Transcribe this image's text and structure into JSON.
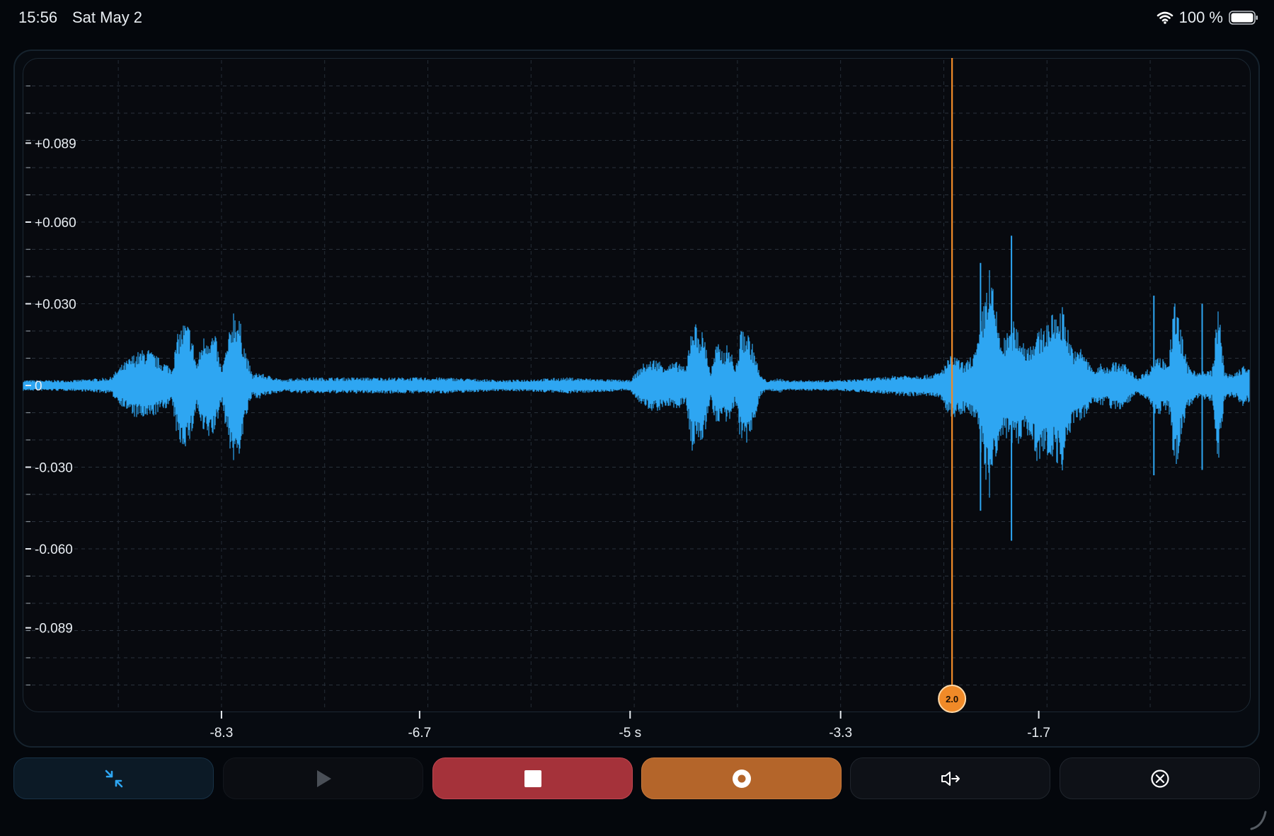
{
  "status_bar": {
    "time": "15:56",
    "date": "Sat May 2",
    "battery_text": "100 %",
    "icons": [
      "wifi-icon",
      "battery-icon"
    ]
  },
  "chart_data": {
    "type": "line",
    "title": "",
    "xlabel": "",
    "ylabel": "",
    "x_ticks": [
      "-8.3",
      "-6.7",
      "-5 s",
      "-3.3",
      "-1.7"
    ],
    "x_tick_values": [
      -8.3,
      -6.7,
      -5.0,
      -3.3,
      -1.7
    ],
    "xlim": [
      -9.9,
      0.0
    ],
    "y_ticks": [
      "+0.089",
      "+0.060",
      "+0.030",
      "0",
      "-0.030",
      "-0.060",
      "-0.089"
    ],
    "y_tick_values": [
      0.089,
      0.06,
      0.03,
      0,
      -0.03,
      -0.06,
      -0.089
    ],
    "ylim": [
      -0.119,
      0.119
    ],
    "grid": true,
    "series_color": "#2ea6f2",
    "series": [
      {
        "name": "",
        "envelope": {
          "x": [
            -9.9,
            -9.5,
            -9.2,
            -9.1,
            -9.0,
            -8.9,
            -8.8,
            -8.7,
            -8.65,
            -8.6,
            -8.55,
            -8.5,
            -8.45,
            -8.4,
            -8.35,
            -8.3,
            -8.25,
            -8.2,
            -8.15,
            -8.1,
            -8.05,
            -8.0,
            -7.95,
            -7.85,
            -7.8,
            -7.7,
            -7.5,
            -7.3,
            -7.0,
            -6.5,
            -6.0,
            -5.5,
            -5.0,
            -4.9,
            -4.8,
            -4.7,
            -4.6,
            -4.55,
            -4.5,
            -4.45,
            -4.4,
            -4.35,
            -4.3,
            -4.25,
            -4.2,
            -4.15,
            -4.1,
            -4.05,
            -4.0,
            -3.95,
            -3.9,
            -3.85,
            -3.8,
            -3.75,
            -3.7,
            -3.65,
            -3.6,
            -3.5,
            -3.3,
            -3.0,
            -2.8,
            -2.6,
            -2.5,
            -2.4,
            -2.3,
            -2.2,
            -2.1,
            -2.0,
            -1.9,
            -1.8,
            -1.7,
            -1.6,
            -1.5,
            -1.45,
            -1.4,
            -1.35,
            -1.3,
            -1.25,
            -1.2,
            -1.15,
            -1.1,
            -1.0,
            -0.9,
            -0.8,
            -0.75,
            -0.7,
            -0.65,
            -0.6,
            -0.5,
            -0.4,
            -0.3,
            -0.25,
            -0.2,
            -0.15,
            -0.1,
            -0.05,
            0.0
          ],
          "max": [
            0.002,
            0.002,
            0.003,
            0.008,
            0.012,
            0.014,
            0.01,
            0.007,
            0.02,
            0.024,
            0.022,
            0.008,
            0.018,
            0.02,
            0.019,
            0.006,
            0.016,
            0.03,
            0.024,
            0.012,
            0.004,
            0.005,
            0.004,
            0.003,
            0.002,
            0.003,
            0.003,
            0.003,
            0.003,
            0.003,
            0.002,
            0.003,
            0.002,
            0.008,
            0.01,
            0.008,
            0.009,
            0.006,
            0.025,
            0.022,
            0.019,
            0.005,
            0.016,
            0.013,
            0.016,
            0.006,
            0.022,
            0.02,
            0.014,
            0.004,
            0.002,
            0.002,
            0.003,
            0.002,
            0.002,
            0.002,
            0.002,
            0.002,
            0.002,
            0.003,
            0.004,
            0.004,
            0.005,
            0.012,
            0.008,
            0.014,
            0.045,
            0.016,
            0.024,
            0.015,
            0.02,
            0.026,
            0.03,
            0.018,
            0.012,
            0.015,
            0.009,
            0.006,
            0.008,
            0.007,
            0.009,
            0.008,
            0.003,
            0.007,
            0.012,
            0.01,
            0.01,
            0.033,
            0.008,
            0.005,
            0.006,
            0.03,
            0.006,
            0.004,
            0.005,
            0.008,
            0.006
          ],
          "min": [
            -0.002,
            -0.002,
            -0.003,
            -0.008,
            -0.012,
            -0.013,
            -0.01,
            -0.007,
            -0.022,
            -0.023,
            -0.021,
            -0.008,
            -0.019,
            -0.02,
            -0.018,
            -0.006,
            -0.02,
            -0.03,
            -0.025,
            -0.012,
            -0.004,
            -0.005,
            -0.004,
            -0.003,
            -0.002,
            -0.003,
            -0.003,
            -0.003,
            -0.003,
            -0.003,
            -0.002,
            -0.003,
            -0.002,
            -0.008,
            -0.01,
            -0.008,
            -0.009,
            -0.006,
            -0.025,
            -0.022,
            -0.02,
            -0.005,
            -0.016,
            -0.013,
            -0.016,
            -0.006,
            -0.024,
            -0.022,
            -0.015,
            -0.004,
            -0.002,
            -0.002,
            -0.003,
            -0.002,
            -0.002,
            -0.002,
            -0.002,
            -0.002,
            -0.002,
            -0.003,
            -0.004,
            -0.004,
            -0.005,
            -0.013,
            -0.01,
            -0.015,
            -0.045,
            -0.018,
            -0.024,
            -0.017,
            -0.03,
            -0.026,
            -0.032,
            -0.02,
            -0.012,
            -0.014,
            -0.01,
            -0.006,
            -0.008,
            -0.007,
            -0.01,
            -0.008,
            -0.003,
            -0.007,
            -0.012,
            -0.01,
            -0.01,
            -0.033,
            -0.008,
            -0.005,
            -0.006,
            -0.03,
            -0.006,
            -0.004,
            -0.005,
            -0.008,
            -0.006
          ]
        },
        "spikes": [
          {
            "x": -2.17,
            "max": 0.045,
            "min": -0.046
          },
          {
            "x": -1.92,
            "max": 0.055,
            "min": -0.057
          },
          {
            "x": -0.77,
            "max": 0.033,
            "min": -0.033
          },
          {
            "x": -0.38,
            "max": 0.03,
            "min": -0.031
          }
        ]
      }
    ],
    "cursor": {
      "x": -2.4,
      "label": "2.0",
      "color": "#f08a28"
    }
  },
  "controls": [
    {
      "name": "collapse",
      "icon": "collapse-arrows-icon"
    },
    {
      "name": "play",
      "icon": "play-icon"
    },
    {
      "name": "stop",
      "icon": "stop-icon"
    },
    {
      "name": "record",
      "icon": "record-icon"
    },
    {
      "name": "speaker",
      "icon": "speaker-output-icon"
    },
    {
      "name": "clear",
      "icon": "close-circle-icon"
    }
  ],
  "colors": {
    "background": "#04070c",
    "waveform": "#2ea6f2",
    "cursor": "#f08a28",
    "stop": "#a5323a",
    "record": "#b4652a"
  }
}
